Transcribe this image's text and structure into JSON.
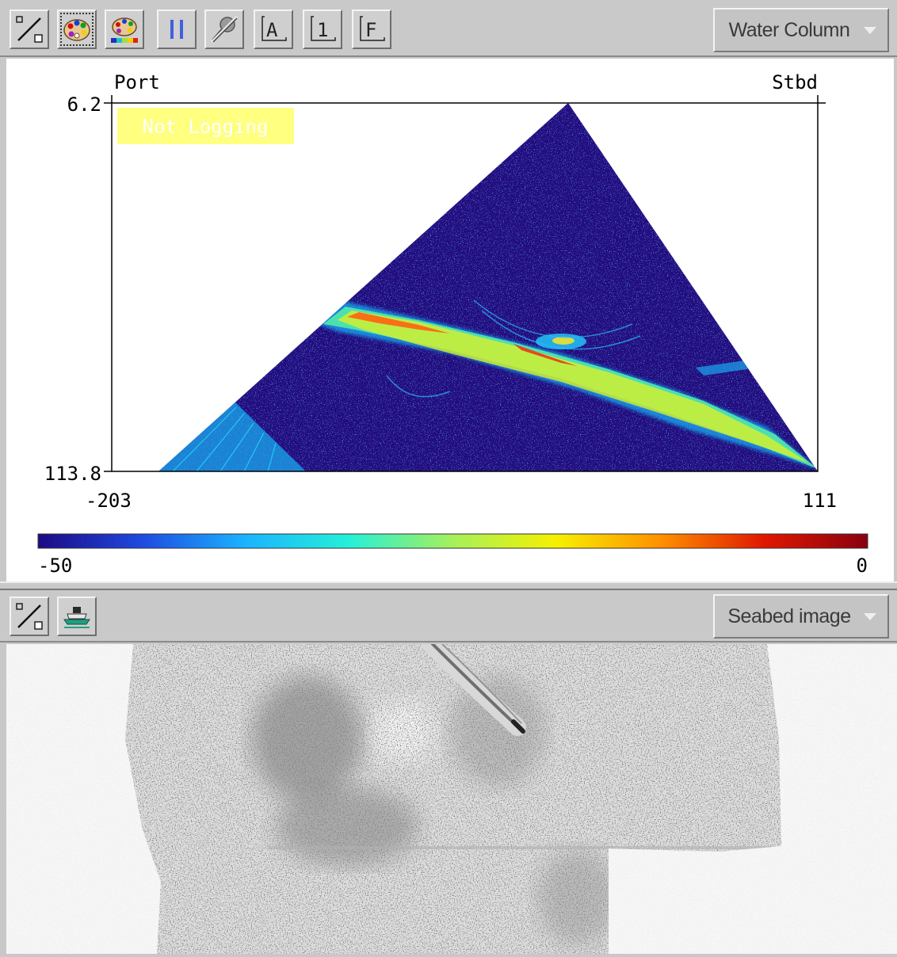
{
  "water_column": {
    "toolbar": {
      "buttons": [
        {
          "name": "display-toggle-button",
          "icon": "diagonal-toggle-icon"
        },
        {
          "name": "palette-button",
          "icon": "palette-icon"
        },
        {
          "name": "color-scale-button",
          "icon": "palette-colorbar-icon"
        },
        {
          "name": "pause-button",
          "icon": "pause-icon"
        },
        {
          "name": "filter-button",
          "icon": "slashed-tool-icon"
        },
        {
          "name": "annotation-a-button",
          "icon": "bracket-a-icon",
          "glyph": "A"
        },
        {
          "name": "annotation-1-button",
          "icon": "bracket-1-icon",
          "glyph": "1"
        },
        {
          "name": "annotation-f-button",
          "icon": "bracket-f-icon",
          "glyph": "F"
        }
      ],
      "mode": "Water Column"
    },
    "plot": {
      "port_label": "Port",
      "stbd_label": "Stbd",
      "y_top": "6.2",
      "y_bottom": "113.8",
      "x_left": "-203",
      "x_right": "111",
      "status_badge": "Not Logging"
    },
    "colorbar": {
      "min_label": "-50",
      "max_label": "0",
      "stops": [
        "#1c0a84",
        "#1e4ae0",
        "#1ab4ff",
        "#26f0d8",
        "#a6f05a",
        "#f6f000",
        "#ff9000",
        "#e01800",
        "#8a0010"
      ]
    }
  },
  "seabed": {
    "toolbar": {
      "buttons": [
        {
          "name": "seabed-display-toggle-button",
          "icon": "diagonal-toggle-icon"
        },
        {
          "name": "vessel-button",
          "icon": "vessel-icon"
        }
      ],
      "mode": "Seabed image"
    }
  },
  "colors": {
    "toolbar_bg": "#c9c9c9",
    "plot_bg": "#ffffff",
    "swath_bg": "#230c7e",
    "status_badge_bg": "#ffff80"
  }
}
